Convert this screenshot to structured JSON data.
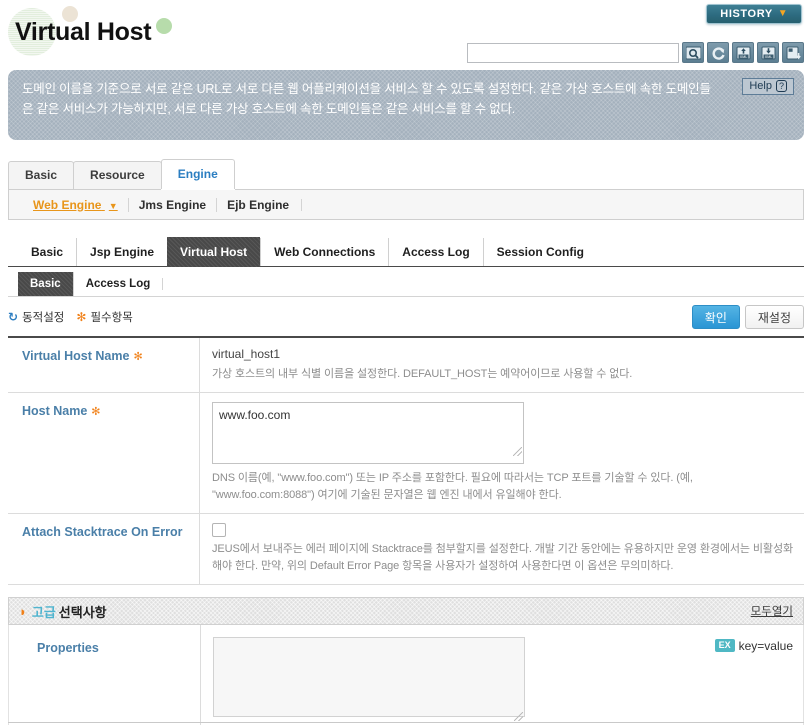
{
  "header": {
    "title": "Virtual Host",
    "history_label": "HISTORY",
    "history_caret": "▼",
    "search_value": "",
    "search_placeholder": "",
    "tools": [
      {
        "name": "search-icon",
        "title": "Search"
      },
      {
        "name": "refresh-icon",
        "title": "Refresh"
      },
      {
        "name": "xml-import-icon",
        "title": "Import XML"
      },
      {
        "name": "xml-export-icon",
        "title": "Export XML"
      },
      {
        "name": "backup-icon",
        "title": "Backup"
      }
    ]
  },
  "banner": {
    "text": "도메인 이름을 기준으로 서로 같은 URL로 서로 다른 웹 어플리케이션을 서비스 할 수 있도록 설정한다. 같은 가상 호스트에 속한 도메인들은 같은 서비스가 가능하지만, 서로 다른 가상 호스트에 속한 도메인들은 같은 서비스를 할 수 없다.",
    "help_label": "Help",
    "help_mark": "?"
  },
  "tabs_level1": [
    {
      "label": "Basic",
      "active": false
    },
    {
      "label": "Resource",
      "active": false
    },
    {
      "label": "Engine",
      "active": true
    }
  ],
  "subnav": [
    {
      "label": "Web Engine",
      "active": true
    },
    {
      "label": "Jms Engine",
      "active": false
    },
    {
      "label": "Ejb Engine",
      "active": false
    }
  ],
  "tabs_level2": [
    {
      "label": "Basic",
      "active": false
    },
    {
      "label": "Jsp Engine",
      "active": false
    },
    {
      "label": "Virtual Host",
      "active": true
    },
    {
      "label": "Web Connections",
      "active": false
    },
    {
      "label": "Access Log",
      "active": false
    },
    {
      "label": "Session Config",
      "active": false
    }
  ],
  "tabs_level3": [
    {
      "label": "Basic",
      "active": true
    },
    {
      "label": "Access Log",
      "active": false
    }
  ],
  "actionbar": {
    "dynamic_icon": "↻",
    "dynamic_label": "동적설정",
    "required_icon": "✻",
    "required_label": "필수항목",
    "confirm_label": "확인",
    "reset_label": "재설정"
  },
  "form": {
    "rows": [
      {
        "label": "Virtual Host Name",
        "required": true,
        "required_mark": "✻",
        "type": "text",
        "value": "virtual_host1",
        "desc": "가상 호스트의 내부 식별 이름을 설정한다. DEFAULT_HOST는 예약어이므로 사용할 수 없다."
      },
      {
        "label": "Host Name",
        "required": true,
        "required_mark": "✻",
        "type": "textarea",
        "value": "www.foo.com",
        "desc": "DNS 이름(예, \"www.foo.com\") 또는 IP 주소를 포함한다. 필요에 따라서는 TCP 포트를 기술할 수 있다. (예, \"www.foo.com:8088\") 여기에 기술된 문자열은 웹 엔진 내에서 유일해야 한다."
      },
      {
        "label": "Attach Stacktrace On Error",
        "required": false,
        "required_mark": "",
        "type": "checkbox",
        "checked": false,
        "value": "",
        "desc": "JEUS에서 보내주는 에러 페이지에 Stacktrace를 첨부할지를 설정한다. 개발 기간 동안에는 유용하지만 운영 환경에서는 비활성화해야 한다. 만약, 위의 Default Error Page 항목을 사용자가 설정하여 사용한다면 이 옵션은 무의미하다."
      }
    ]
  },
  "advanced": {
    "bulb_icon": "♀",
    "title_strong": "고급",
    "title_rest": "선택사항",
    "expand_all_label": "모두열기",
    "properties": {
      "label": "Properties",
      "value": "",
      "hint_badge": "EX",
      "hint_text": "key=value"
    }
  },
  "colors": {
    "accent_blue": "#2a95d4",
    "label_blue": "#4a7fa8",
    "required_orange": "#f08018",
    "active_orange": "#e8951a",
    "banner_gray": "#a4b1bd",
    "tab_dark": "#494949",
    "teal_badge": "#4fb8c4",
    "history_teal": "#2d6b80"
  }
}
